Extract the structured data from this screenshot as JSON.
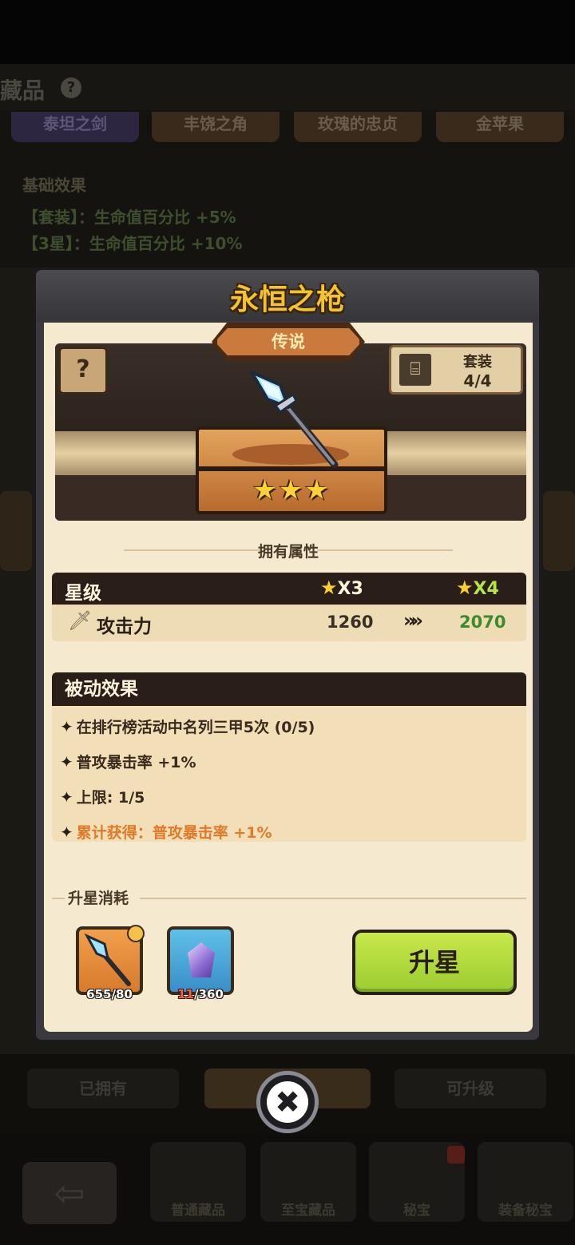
{
  "background": {
    "page_title": "藏品",
    "help_icon": "question-mark",
    "tabs": [
      "泰坦之剑",
      "丰饶之角",
      "玫瑰的忠贞",
      "金苹果"
    ],
    "base_effect_title": "基础效果",
    "base_effect_lines": [
      "【套装】：生命值百分比 +5%",
      "【3星】：生命值百分比 +10%"
    ],
    "filter_left": "已拥有",
    "filter_right": "可升级",
    "nav": [
      "普通藏品",
      "至宝藏品",
      "秘宝",
      "装备秘宝"
    ]
  },
  "modal": {
    "title": "永恒之枪",
    "rarity": "传说",
    "set": {
      "label": "套装",
      "value": "4/4"
    },
    "star_count": 3,
    "section_attributes": "拥有属性",
    "attributes": {
      "header_label": "星级",
      "current_star": "X3",
      "next_star": "X4",
      "rows": [
        {
          "icon": "sword-icon",
          "name": "攻击力",
          "current": "1260",
          "next": "2070"
        }
      ]
    },
    "passive": {
      "title": "被动效果",
      "lines": [
        "在排行榜活动中名列三甲5次 (0/5)",
        "普攻暴击率 +1%",
        "上限: 1/5",
        "累计获得：普攻暴击率 +1%"
      ]
    },
    "upgrade_cost_title": "升星消耗",
    "materials": [
      {
        "icon": "spear-icon",
        "count": "655/80"
      },
      {
        "icon": "crystal-icon",
        "have": "11",
        "need": "/360"
      }
    ],
    "upgrade_button": "升星",
    "close_icon": "close-icon"
  },
  "colors": {
    "title_gold": "#f4c430",
    "panel_cream": "#f5e9cf",
    "header_dark": "#2a1f18",
    "next_value_green": "#3d8a2a",
    "accumulated_orange": "#e07a2a",
    "button_green": "#b4dc3e"
  }
}
